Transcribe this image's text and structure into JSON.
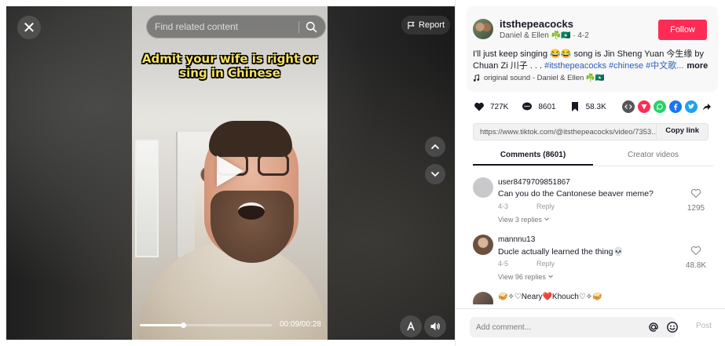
{
  "player": {
    "search_placeholder": "Find related content",
    "report_label": "Report",
    "caption": "Admit your wife is right or sing in Chinese",
    "time": "00:09/00:28",
    "progress": 0.33
  },
  "author": {
    "username": "itsthepeacocks",
    "nickname": "Daniel & Ellen ☘️🇲🇴 · 4-2",
    "follow_label": "Follow"
  },
  "description": {
    "text": "I'll just keep singing 😂😂 song is Jin Sheng Yuan 今生缘 by Chuan Zi 川子 . . . ",
    "tags": "#itsthepeacocks #chinese #中文歌...",
    "more": "more",
    "sound": "original sound - Daniel & Ellen ☘️🇲🇴"
  },
  "stats": {
    "likes": "727K",
    "comments": "8601",
    "saves": "58.3K"
  },
  "share": {
    "url": "https://www.tiktok.com/@itsthepeacocks/video/7353...",
    "copy_label": "Copy link"
  },
  "tabs": [
    {
      "label": "Comments (8601)"
    },
    {
      "label": "Creator videos"
    }
  ],
  "comments": [
    {
      "user": "user8479709851867",
      "text": "Can you do the Cantonese beaver meme?",
      "date": "4-3",
      "reply": "Reply",
      "replies": "View 3 replies",
      "likes": "1295"
    },
    {
      "user": "mannnu13",
      "text": "Ducle actually learned the thing💀",
      "date": "4-5",
      "reply": "Reply",
      "replies": "View 96 replies",
      "likes": "48.8K"
    },
    {
      "user": "🥪✧♡Neary❤️Khouch♡✧🥪",
      "text": "",
      "date": "",
      "reply": "",
      "replies": "",
      "likes": ""
    }
  ],
  "composer": {
    "placeholder": "Add comment...",
    "post_label": "Post"
  },
  "colors": {
    "accent": "#fe2c55",
    "hashtag": "#2b5db9"
  }
}
